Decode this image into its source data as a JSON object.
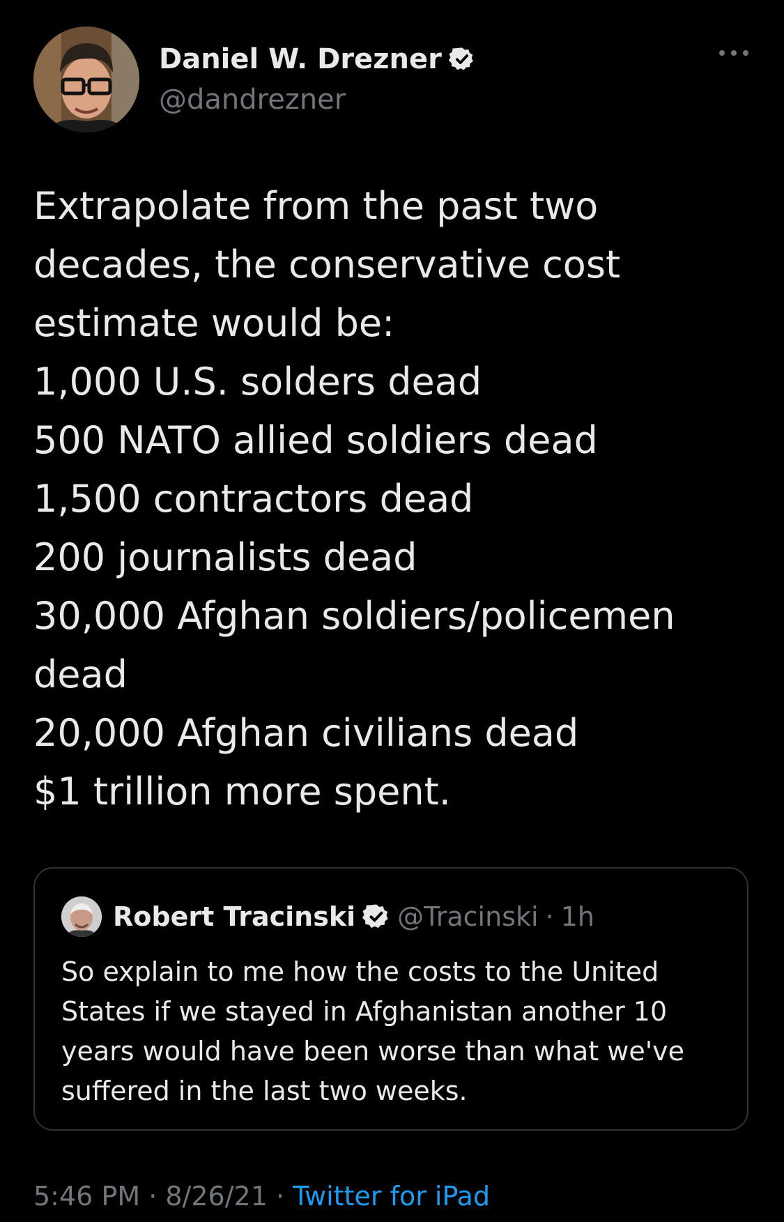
{
  "author": {
    "display_name": "Daniel W. Drezner",
    "handle": "@dandrezner",
    "avatar_icon": "profile-photo-icon",
    "verified_icon": "verified-badge-icon"
  },
  "tweet": {
    "text": "Extrapolate from the past two\ndecades, the conservative cost\nestimate would be:\n1,000 U.S. solders dead\n500 NATO allied soldiers dead\n1,500 contractors dead\n200 journalists dead\n30,000 Afghan soldiers/policemen\ndead\n20,000 Afghan civilians dead\n$1 trillion more spent."
  },
  "quoted_tweet": {
    "display_name": "Robert Tracinski",
    "handle": "@Tracinski",
    "separator": "·",
    "time": "1h",
    "text": "So explain to me how the costs to the United States if we stayed in Afghanistan another 10 years would have been worse than what we've suffered in the last two weeks."
  },
  "meta": {
    "time": "5:46 PM",
    "sep1": " · ",
    "date": "8/26/21",
    "sep2": " · ",
    "source": "Twitter for iPad"
  },
  "colors": {
    "background": "#000000",
    "text": "#e7e9ea",
    "secondary": "#71767b",
    "accent": "#1d9bf0",
    "border": "#2f3336"
  }
}
